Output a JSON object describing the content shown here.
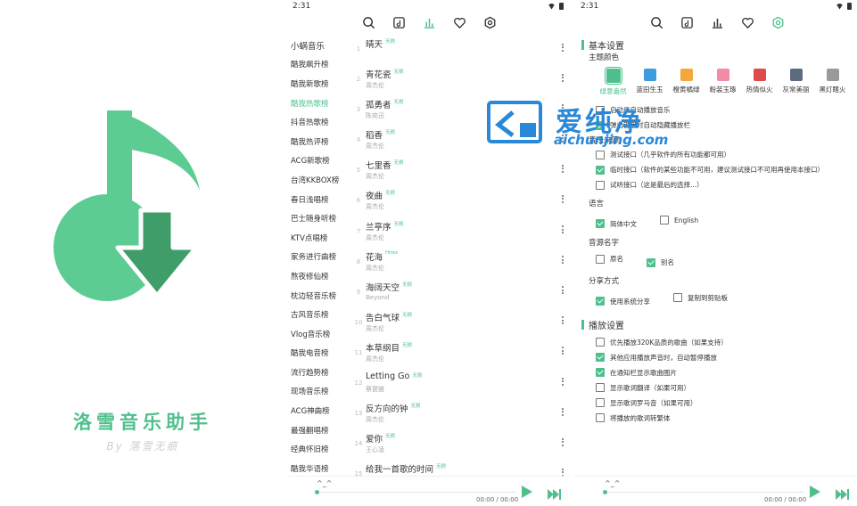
{
  "colors": {
    "accent": "#4fc08d",
    "accent_dark": "#3fa478",
    "logo_light": "#5dcc93",
    "logo_arrow": "#3f9d6a",
    "watermark": "#2a88d8"
  },
  "splash": {
    "app_name": "洛雪音乐助手",
    "author": "By 落雪无痕"
  },
  "statusbar": {
    "time": "2:31"
  },
  "toolbar": {
    "icons": [
      "search-icon",
      "song-list-icon",
      "leaderboard-icon",
      "heart-icon",
      "settings-icon"
    ]
  },
  "leaderboard": {
    "source": "小蜗音乐",
    "boards": [
      "酷我飙升榜",
      "酷我新歌榜",
      "酷我热歌榜",
      "抖音热歌榜",
      "酷我热评榜",
      "ACG新歌榜",
      "台湾KKBOX榜",
      "春日浅唱榜",
      "巴士随身听榜",
      "KTV点唱榜",
      "家务进行曲榜",
      "熬夜修仙榜",
      "枕边轻音乐榜",
      "古风音乐榜",
      "Vlog音乐榜",
      "酷我电音榜",
      "流行趋势榜",
      "现场音乐榜",
      "ACG神曲榜",
      "最强翻唱榜",
      "经典怀旧榜",
      "酷我华语榜"
    ],
    "active_index": 2,
    "songs": [
      {
        "num": "1",
        "name": "晴天",
        "badge": "无损",
        "singer": ""
      },
      {
        "num": "2",
        "name": "青花瓷",
        "badge": "无损",
        "singer": "周杰伦"
      },
      {
        "num": "3",
        "name": "孤勇者",
        "badge": "无损",
        "singer": "陈奕迅"
      },
      {
        "num": "4",
        "name": "稻香",
        "badge": "无损",
        "singer": "周杰伦"
      },
      {
        "num": "5",
        "name": "七里香",
        "badge": "无损",
        "singer": "周杰伦"
      },
      {
        "num": "6",
        "name": "夜曲",
        "badge": "无损",
        "singer": "周杰伦"
      },
      {
        "num": "7",
        "name": "兰亭序",
        "badge": "无损",
        "singer": "周杰伦"
      },
      {
        "num": "8",
        "name": "花海",
        "badge": "Hires",
        "singer": "周杰伦"
      },
      {
        "num": "9",
        "name": "海阔天空",
        "badge": "无损",
        "singer": "Beyond"
      },
      {
        "num": "10",
        "name": "告白气球",
        "badge": "无损",
        "singer": "周杰伦"
      },
      {
        "num": "11",
        "name": "本草纲目",
        "badge": "无损",
        "singer": "周杰伦"
      },
      {
        "num": "12",
        "name": "Letting Go",
        "badge": "无损",
        "singer": "蔡健雅"
      },
      {
        "num": "13",
        "name": "反方向的钟",
        "badge": "无损",
        "singer": "周杰伦"
      },
      {
        "num": "14",
        "name": "爱你",
        "badge": "无损",
        "singer": "王心凌"
      },
      {
        "num": "15",
        "name": "给我一首歌的时间",
        "badge": "无损",
        "singer": ""
      }
    ]
  },
  "player": {
    "pic": "^_^",
    "time": "00:00 / 00:00",
    "progress": 0
  },
  "settings": {
    "basic_title": "基本设置",
    "theme_title": "主题颜色",
    "themes": [
      {
        "label": "绿意盎然",
        "color": "#4fc08d"
      },
      {
        "label": "蓝田生玉",
        "color": "#3d9be0"
      },
      {
        "label": "橙黄橘绿",
        "color": "#f4a83c"
      },
      {
        "label": "粉装玉琢",
        "color": "#f28ba6"
      },
      {
        "label": "热情似火",
        "color": "#e04a4a"
      },
      {
        "label": "灰常美丽",
        "color": "#5c6b7f"
      },
      {
        "label": "黑灯瞎火",
        "color": "#9a9a9a"
      }
    ],
    "theme_selected": 0,
    "startup_options": [
      {
        "label": "启动后自动播放音乐",
        "checked": false
      },
      {
        "label": "弹出键盘时自动隐藏播放栏",
        "checked": true
      }
    ],
    "source_title": "音乐来源",
    "sources": [
      {
        "label": "测试接口（几乎软件的所有功能都可用）",
        "checked": false
      },
      {
        "label": "临时接口（软件的某些功能不可用，建议测试接口不可用再使用本接口）",
        "checked": true
      },
      {
        "label": "试听接口（这是最后的选择...）",
        "checked": false
      }
    ],
    "lang_title": "语言",
    "langs": [
      {
        "label": "简体中文",
        "checked": true
      },
      {
        "label": "English",
        "checked": false
      }
    ],
    "srcname_title": "音源名字",
    "srcnames": [
      {
        "label": "原名",
        "checked": false
      },
      {
        "label": "别名",
        "checked": true
      }
    ],
    "share_title": "分享方式",
    "shares": [
      {
        "label": "使用系统分享",
        "checked": true
      },
      {
        "label": "复制到剪贴板",
        "checked": false
      }
    ],
    "play_title": "播放设置",
    "play_options": [
      {
        "label": "优先播放320K品质的歌曲（如果支持）",
        "checked": false
      },
      {
        "label": "其他应用播放声音时，自动暂停播放",
        "checked": true
      },
      {
        "label": "在通知栏显示歌曲图片",
        "checked": true
      },
      {
        "label": "显示歌词翻译（如果可用）",
        "checked": false
      },
      {
        "label": "显示歌词罗马音（如果可用）",
        "checked": false
      },
      {
        "label": "将播放的歌词转繁体",
        "checked": false
      }
    ]
  },
  "watermark": {
    "cn": "爱纯净",
    "en": "aichunjing.com"
  }
}
